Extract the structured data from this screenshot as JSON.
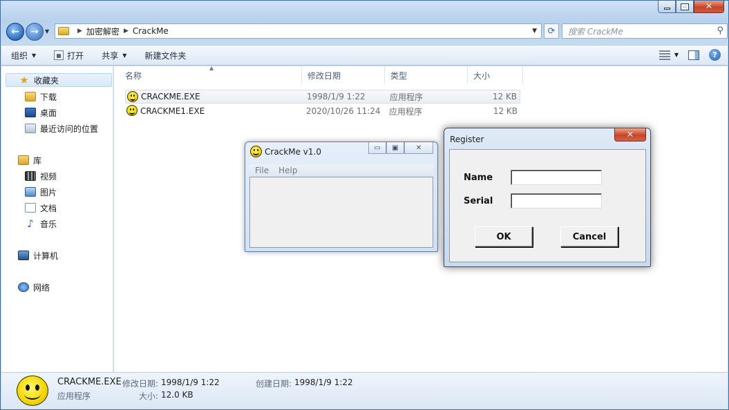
{
  "explorer": {
    "breadcrumb": [
      "加密解密",
      "CrackMe"
    ],
    "search_placeholder": "搜索 CrackMe",
    "toolbar": {
      "organize": "组织",
      "open": "打开",
      "share": "共享",
      "new_folder": "新建文件夹"
    },
    "sidebar": {
      "favorites": "收藏夹",
      "downloads": "下载",
      "desktop": "桌面",
      "recent": "最近访问的位置",
      "libraries": "库",
      "videos": "视频",
      "pictures": "图片",
      "documents": "文档",
      "music": "音乐",
      "computer": "计算机",
      "network": "网络"
    },
    "columns": [
      "名称",
      "修改日期",
      "类型",
      "大小"
    ],
    "files": [
      {
        "name": "CRACKME.EXE",
        "date": "1998/1/9 1:22",
        "type": "应用程序",
        "size": "12 KB"
      },
      {
        "name": "CRACKME1.EXE",
        "date": "2020/10/26 11:24",
        "type": "应用程序",
        "size": "12 KB"
      }
    ],
    "details": {
      "name": "CRACKME.EXE",
      "type": "应用程序",
      "modified_label": "修改日期:",
      "modified_value": "1998/1/9 1:22",
      "created_label": "创建日期:",
      "created_value": "1998/1/9 1:22",
      "size_label": "大小:",
      "size_value": "12.0 KB"
    }
  },
  "crackme": {
    "title": "CrackMe v1.0",
    "menu": [
      "File",
      "Help"
    ]
  },
  "register": {
    "title": "Register",
    "name_label": "Name",
    "serial_label": "Serial",
    "name_value": "",
    "serial_value": "",
    "ok": "OK",
    "cancel": "Cancel"
  },
  "icons": {
    "app": "smiley-icon",
    "favorites": "star-icon",
    "back": "back-arrow-icon",
    "forward": "forward-arrow-icon",
    "search": "search-icon",
    "refresh": "refresh-icon",
    "help": "help-icon"
  },
  "colors": {
    "accent": "#2e6fc0",
    "close_button": "#c7452a",
    "smiley": "#f2d600"
  }
}
